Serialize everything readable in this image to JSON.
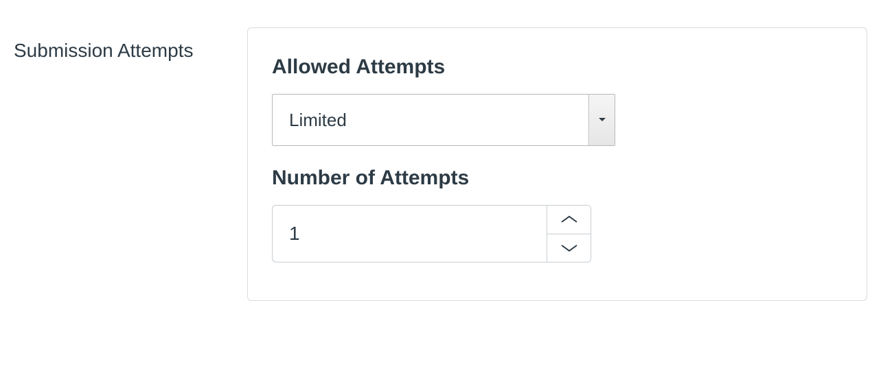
{
  "section": {
    "label": "Submission Attempts"
  },
  "allowed_attempts": {
    "label": "Allowed Attempts",
    "selected_value": "Limited"
  },
  "number_of_attempts": {
    "label": "Number of Attempts",
    "value": "1"
  }
}
